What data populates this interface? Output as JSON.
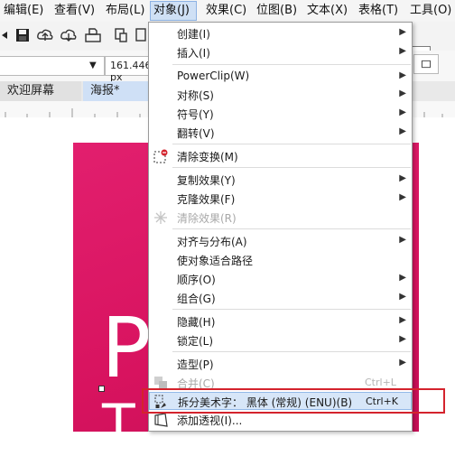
{
  "menubar": {
    "items": [
      {
        "label": "编辑(E)"
      },
      {
        "label": "查看(V)"
      },
      {
        "label": "布局(L)"
      },
      {
        "label": "对象(J)"
      },
      {
        "label": "效果(C)"
      },
      {
        "label": "位图(B)"
      },
      {
        "label": "文本(X)"
      },
      {
        "label": "表格(T)"
      },
      {
        "label": "工具(O)"
      }
    ]
  },
  "propbar": {
    "size_value": "161.446 px"
  },
  "tabs": {
    "welcome": "欢迎屏幕",
    "poster": "海报*"
  },
  "poster": {
    "letter_top": "P",
    "letter_bottom": "T"
  },
  "menu": {
    "items": [
      {
        "label": "创建(I)",
        "submenu": true
      },
      {
        "label": "插入(I)",
        "submenu": true
      },
      {
        "label": "PowerClip(W)",
        "submenu": true
      },
      {
        "label": "对称(S)",
        "submenu": true
      },
      {
        "label": "符号(Y)",
        "submenu": true
      },
      {
        "label": "翻转(V)",
        "submenu": true
      },
      {
        "label": "清除变换(M)",
        "submenu": false
      },
      {
        "label": "复制效果(Y)",
        "submenu": true
      },
      {
        "label": "克隆效果(F)",
        "submenu": true
      },
      {
        "label": "清除效果(R)",
        "submenu": false,
        "disabled": true
      },
      {
        "label": "对齐与分布(A)",
        "submenu": true
      },
      {
        "label": "使对象适合路径",
        "submenu": false
      },
      {
        "label": "顺序(O)",
        "submenu": true
      },
      {
        "label": "组合(G)",
        "submenu": true
      },
      {
        "label": "隐藏(H)",
        "submenu": true
      },
      {
        "label": "锁定(L)",
        "submenu": true
      },
      {
        "label": "造型(P)",
        "submenu": true
      },
      {
        "label": "合并(C)",
        "shortcut": "Ctrl+L",
        "disabled": true
      },
      {
        "label": "拆分美术字： 黑体 (常规) (ENU)(B)",
        "shortcut": "Ctrl+K",
        "highlighted": true
      },
      {
        "label": "添加透视(I)..."
      }
    ]
  },
  "colors": {
    "poster": "#e01b6a",
    "highlight_box": "#d4232d",
    "menu_highlight": "#d7e6f8"
  }
}
